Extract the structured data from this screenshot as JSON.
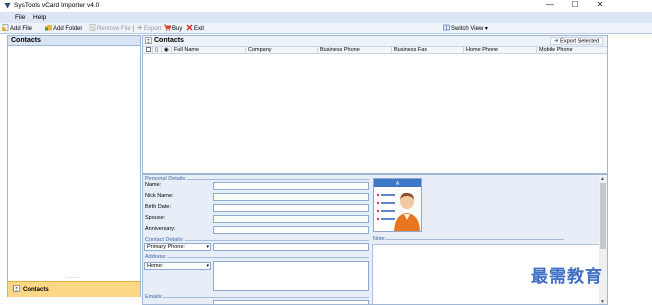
{
  "window": {
    "title": "SysTools vCard Importer v4.0",
    "minimize": "—",
    "maximize": "☐",
    "close": "✕"
  },
  "menu": {
    "items": [
      "File",
      "Help"
    ]
  },
  "toolbar": {
    "add_file": "Add File",
    "add_folder": "Add Folder",
    "remove_file": "Remove File",
    "export": "Export",
    "buy": "Buy",
    "exit": "Exit",
    "switch_view": "Switch View"
  },
  "left_pane": {
    "header": "Contacts",
    "splitter": "·······",
    "bottom_tab": "Contacts"
  },
  "contacts_list": {
    "title": "Contacts",
    "export_selected": "Export Selected",
    "columns": [
      "Full Name",
      "Company",
      "Business Phone",
      "Business Fax",
      "Home Phone",
      "Mobile Phone"
    ]
  },
  "details": {
    "personal_label": "Personal Details:",
    "name_label": "Name:",
    "nick_label": "Nick Name:",
    "birth_label": "Birth Date:",
    "spouse_label": "Spouse:",
    "anniversary_label": "Anniversary:",
    "contact_label": "Contact Details:",
    "phone_select": "Primary Phone:",
    "address_label": "Address:",
    "address_select": "Home:",
    "emails_label": "Emails:",
    "note_label": "Note:"
  },
  "watermark": "最需教育",
  "colors": {
    "menubar": "#dce6f4",
    "accent_tab": "#fbd786",
    "section_text": "#3d67a9",
    "watermark": "#3f6fc4"
  }
}
